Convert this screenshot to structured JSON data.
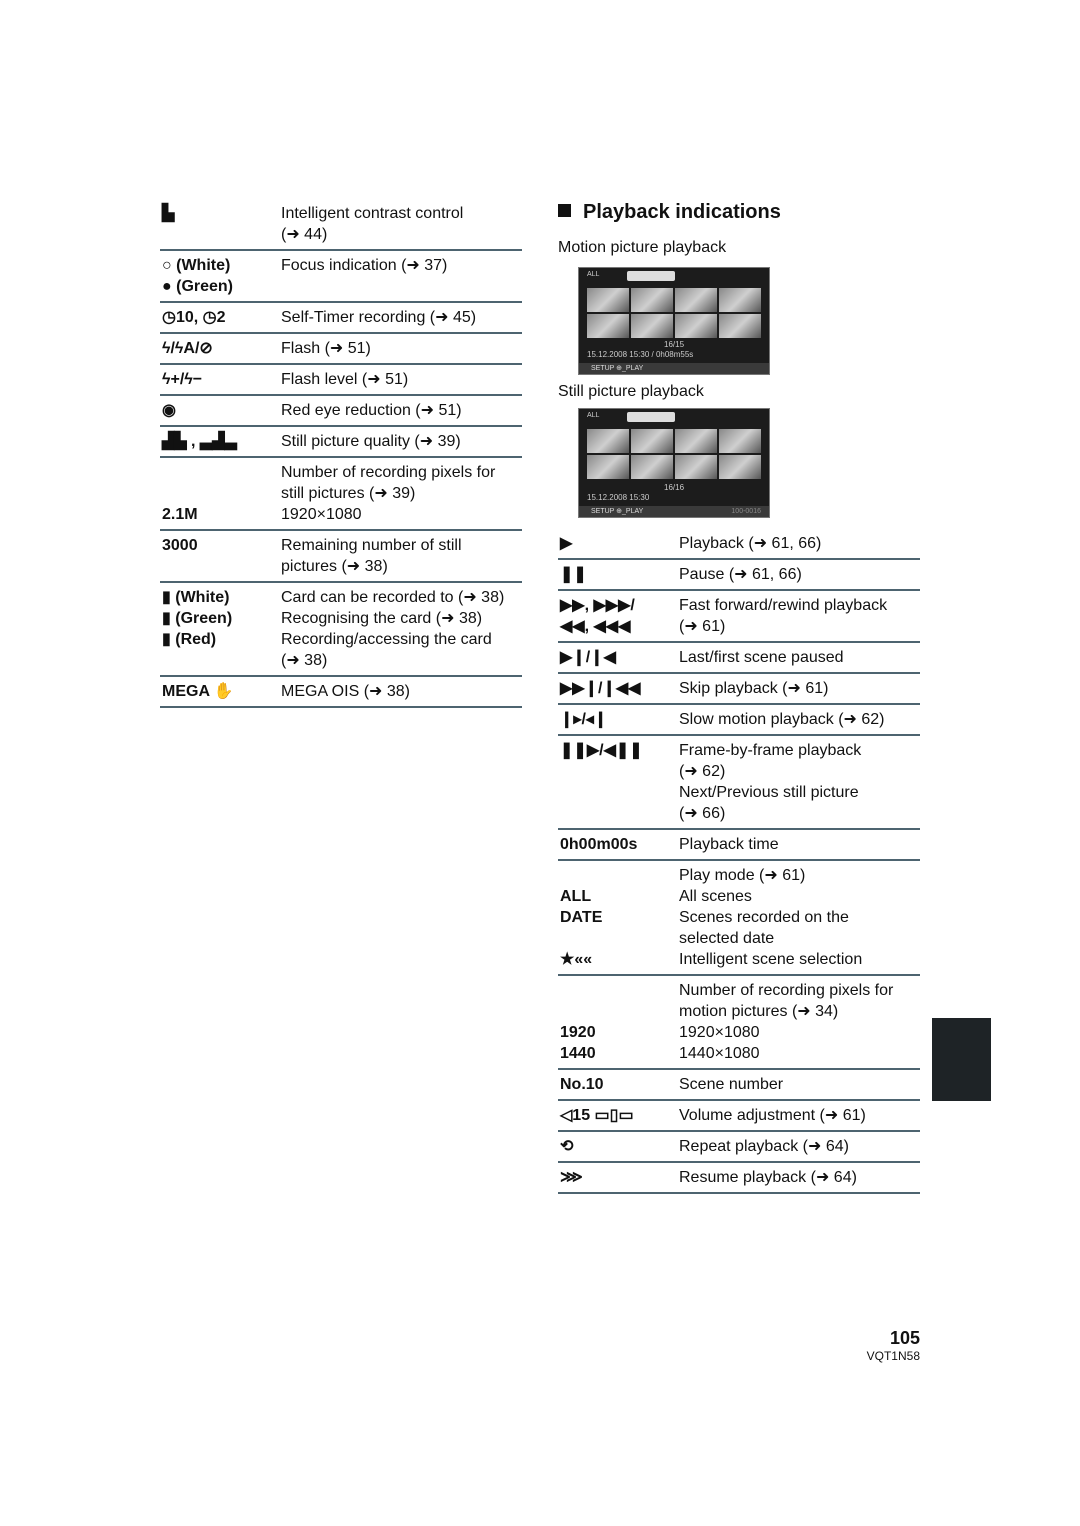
{
  "left_table": [
    {
      "icon": "▙",
      "desc": "Intelligent contrast control\n(➜ 44)"
    },
    {
      "icon": "○ (White)\n● (Green)",
      "desc": "Focus indication (➜ 37)"
    },
    {
      "icon": "◷10, ◷2",
      "desc": "Self-Timer recording (➜ 45)"
    },
    {
      "icon": "ϟ/ϟA/⊘",
      "desc": "Flash (➜ 51)"
    },
    {
      "icon": "ϟ+/ϟ−",
      "desc": "Flash level (➜ 51)"
    },
    {
      "icon": "◉",
      "desc": "Red eye reduction (➜ 51)"
    },
    {
      "icon": "▟▙ , ▃▟▃",
      "desc": "Still picture quality (➜ 39)"
    },
    {
      "icon": "\n\n2.1M",
      "desc": "Number of recording pixels for\nstill pictures (➜ 39)\n1920×1080"
    },
    {
      "icon": "3000",
      "desc": "Remaining number of still\npictures (➜ 38)"
    },
    {
      "icon": "▮  (White)\n▮  (Green)\n▮  (Red)",
      "desc": "Card can be recorded to (➜ 38)\nRecognising the card (➜ 38)\nRecording/accessing the card\n(➜ 38)"
    },
    {
      "icon": "MEGA ✋",
      "desc": "MEGA OIS (➜ 38)"
    }
  ],
  "section": {
    "title": "Playback indications",
    "motion_label": "Motion picture playback",
    "still_label": "Still picture playback"
  },
  "screens": {
    "motion": {
      "counter": "16/15",
      "datetime": "15.12.2008 15:30 / 0h08m55s",
      "bar": "SETUP  ⊕_PLAY",
      "mode": "ALL"
    },
    "still": {
      "counter": "16/16",
      "datetime": "15.12.2008 15:30",
      "bar": "SETUP  ⊕_PLAY",
      "file": "100-0016",
      "mode": "ALL"
    }
  },
  "right_table": [
    {
      "icon": "▶",
      "desc": "Playback (➜ 61, 66)"
    },
    {
      "icon": "❚❚",
      "desc": "Pause (➜ 61, 66)"
    },
    {
      "icon": "▶▶, ▶▶▶/\n◀◀, ◀◀◀",
      "desc": "Fast forward/rewind playback\n(➜ 61)"
    },
    {
      "icon": "▶❙/❙◀",
      "desc": "Last/first scene paused"
    },
    {
      "icon": "▶▶❙/❙◀◀",
      "desc": "Skip playback (➜ 61)"
    },
    {
      "icon": "❙▸/◂❙",
      "desc": "Slow motion playback (➜ 62)"
    },
    {
      "icon": "❚❚▶/◀❚❚",
      "desc": "Frame-by-frame playback\n(➜ 62)\nNext/Previous still picture\n(➜ 66)"
    },
    {
      "icon": "0h00m00s",
      "desc": "Playback time"
    },
    {
      "icon": "\nALL\nDATE\n\n★««",
      "desc": "Play mode (➜ 61)\nAll scenes\nScenes recorded on the\nselected date\nIntelligent scene selection"
    },
    {
      "icon": "\n\n1920\n1440",
      "desc": "Number of recording pixels for\nmotion pictures (➜ 34)\n1920×1080\n1440×1080"
    },
    {
      "icon": "No.10",
      "desc": "Scene number"
    },
    {
      "icon": "◁15 ▭▯▭",
      "desc": "Volume adjustment (➜ 61)"
    },
    {
      "icon": "⟲",
      "desc": "Repeat playback (➜ 64)"
    },
    {
      "icon": "⋙",
      "desc": "Resume playback (➜ 64)"
    }
  ],
  "footer": {
    "page": "105",
    "code": "VQT1N58"
  }
}
